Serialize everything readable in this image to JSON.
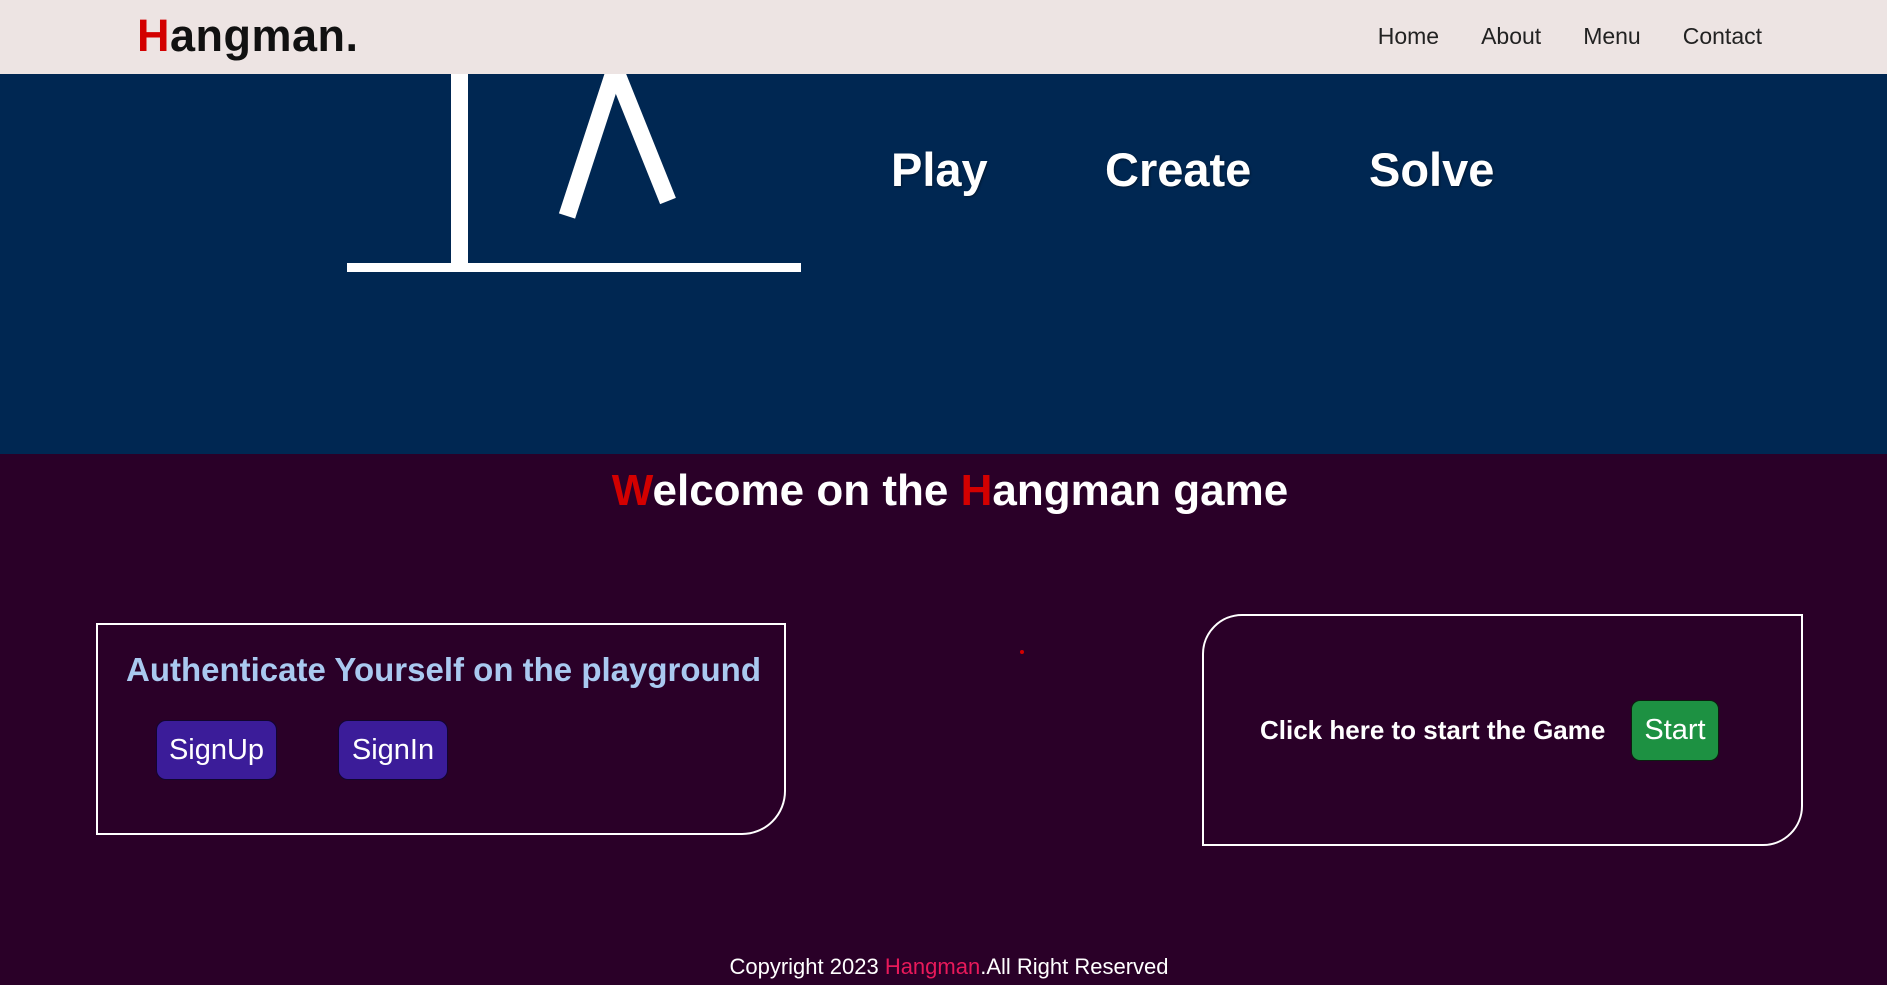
{
  "nav": {
    "logo_first_letter": "H",
    "logo_rest": "angman.",
    "links": [
      "Home",
      "About",
      "Menu",
      "Contact"
    ]
  },
  "hero": {
    "links": [
      "Play",
      "Create",
      "Solve"
    ]
  },
  "main": {
    "title_w": "W",
    "title_part1": "elcome on the ",
    "title_h": "H",
    "title_part2": "angman game"
  },
  "auth": {
    "title": "Authenticate Yourself on the playground",
    "signup_label": "SignUp",
    "signin_label": "SignIn"
  },
  "start": {
    "label": "Click here to start the Game",
    "button_label": "Start"
  },
  "footer": {
    "prefix": "Copyright 2023 ",
    "brand": "Hangman",
    "suffix": ".All Right Reserved"
  },
  "colors": {
    "nav_bg": "#ede4e3",
    "hero_bg": "#002752",
    "page_bg": "#2a0028",
    "accent_red": "#d30000",
    "auth_title": "#a9c9f0",
    "auth_button": "#3b1c99",
    "start_button": "#1d9142",
    "footer_brand": "#e8195a"
  }
}
